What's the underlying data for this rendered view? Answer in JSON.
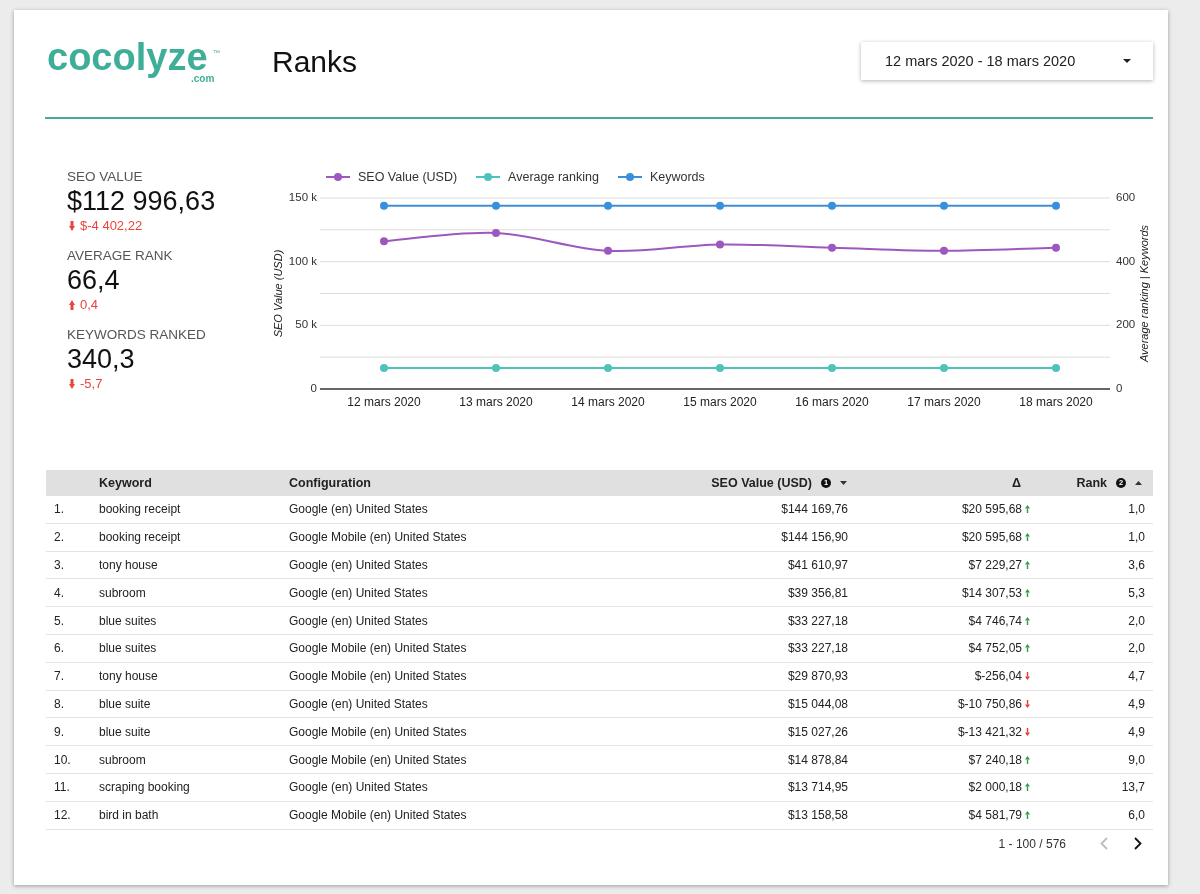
{
  "header": {
    "logo": {
      "wordmark": "cocolyze",
      "trademark": "™",
      "domain": ".com"
    },
    "title": "Ranks",
    "date_range": "12 mars 2020 - 18 mars 2020"
  },
  "kpis": [
    {
      "label": "SEO VALUE",
      "value": "$112 996,63",
      "change": "$-4 402,22",
      "increase": false,
      "favorable": false
    },
    {
      "label": "AVERAGE RANK",
      "value": "66,4",
      "change": "0,4",
      "increase": true,
      "favorable": false
    },
    {
      "label": "KEYWORDS RANKED",
      "value": "340,3",
      "change": "-5,7",
      "increase": false,
      "favorable": false
    }
  ],
  "chart": {
    "chart_data": {
      "type": "line",
      "ylabel": "SEO Value (USD)",
      "y2label": "Average ranking | Keywords",
      "legend": "top",
      "grid": true,
      "marker": "circle",
      "categories": [
        "12 mars 2020",
        "13 mars 2020",
        "14 mars 2020",
        "15 mars 2020",
        "16 mars 2020",
        "17 mars 2020",
        "18 mars 2020"
      ],
      "series": [
        {
          "name": "SEO Value (USD)",
          "color": "#9c58be",
          "values": [
            116000,
            122500,
            108500,
            113500,
            111000,
            108500,
            111000
          ]
        },
        {
          "name": "Average ranking",
          "color": "#4dc3bd",
          "axis": "y2",
          "values": [
            66,
            66,
            66,
            66,
            66,
            66,
            66
          ]
        },
        {
          "name": "Keywords",
          "color": "#3b8edb",
          "axis": "y2",
          "values": [
            576,
            576,
            576,
            576,
            576,
            576,
            576
          ]
        }
      ],
      "ylim": [
        0,
        150000
      ],
      "y2lim": [
        0,
        600
      ],
      "yticks": [
        {
          "value": 0,
          "label": "0"
        },
        {
          "value": 50000,
          "label": "50 k"
        },
        {
          "value": 100000,
          "label": "100 k"
        },
        {
          "value": 150000,
          "label": "150 k"
        }
      ],
      "y2ticks": [
        0,
        200,
        400,
        600
      ]
    }
  },
  "table": {
    "columns": [
      {
        "label": "Keyword",
        "sorted": false
      },
      {
        "label": "Configuration",
        "sorted": false
      },
      {
        "label": "SEO Value (USD)",
        "note": "1",
        "sorted": true,
        "descending": true
      },
      {
        "label": "Δ",
        "sorted": false
      },
      {
        "label": "Rank",
        "note": "2",
        "sorted": true,
        "descending": false
      }
    ],
    "rows": [
      {
        "index": "1.",
        "keyword": "booking receipt",
        "configuration": "Google (en) United States",
        "seo_value": "$144 169,76",
        "delta": "$20 595,68",
        "increase": true,
        "rank": "1,0"
      },
      {
        "index": "2.",
        "keyword": "booking receipt",
        "configuration": "Google Mobile (en) United States",
        "seo_value": "$144 156,90",
        "delta": "$20 595,68",
        "increase": true,
        "rank": "1,0"
      },
      {
        "index": "3.",
        "keyword": "tony house",
        "configuration": "Google (en) United States",
        "seo_value": "$41 610,97",
        "delta": "$7 229,27",
        "increase": true,
        "rank": "3,6"
      },
      {
        "index": "4.",
        "keyword": "subroom",
        "configuration": "Google (en) United States",
        "seo_value": "$39 356,81",
        "delta": "$14 307,53",
        "increase": true,
        "rank": "5,3"
      },
      {
        "index": "5.",
        "keyword": "blue suites",
        "configuration": "Google (en) United States",
        "seo_value": "$33 227,18",
        "delta": "$4 746,74",
        "increase": true,
        "rank": "2,0"
      },
      {
        "index": "6.",
        "keyword": "blue suites",
        "configuration": "Google Mobile (en) United States",
        "seo_value": "$33 227,18",
        "delta": "$4 752,05",
        "increase": true,
        "rank": "2,0"
      },
      {
        "index": "7.",
        "keyword": "tony house",
        "configuration": "Google Mobile (en) United States",
        "seo_value": "$29 870,93",
        "delta": "$-256,04",
        "increase": false,
        "rank": "4,7"
      },
      {
        "index": "8.",
        "keyword": "blue suite",
        "configuration": "Google (en) United States",
        "seo_value": "$15 044,08",
        "delta": "$-10 750,86",
        "increase": false,
        "rank": "4,9"
      },
      {
        "index": "9.",
        "keyword": "blue suite",
        "configuration": "Google Mobile (en) United States",
        "seo_value": "$15 027,26",
        "delta": "$-13 421,32",
        "increase": false,
        "rank": "4,9"
      },
      {
        "index": "10.",
        "keyword": "subroom",
        "configuration": "Google Mobile (en) United States",
        "seo_value": "$14 878,84",
        "delta": "$7 240,18",
        "increase": true,
        "rank": "9,0"
      },
      {
        "index": "11.",
        "keyword": "scraping booking",
        "configuration": "Google (en) United States",
        "seo_value": "$13 714,95",
        "delta": "$2 000,18",
        "increase": true,
        "rank": "13,7"
      },
      {
        "index": "12.",
        "keyword": "bird in bath",
        "configuration": "Google Mobile (en) United States",
        "seo_value": "$13 158,58",
        "delta": "$4 581,79",
        "increase": true,
        "rank": "6,0"
      }
    ]
  },
  "pagination": {
    "range": "1 - 100 / 576",
    "previous": {
      "disabled": true
    },
    "next": {
      "disabled": false
    }
  }
}
